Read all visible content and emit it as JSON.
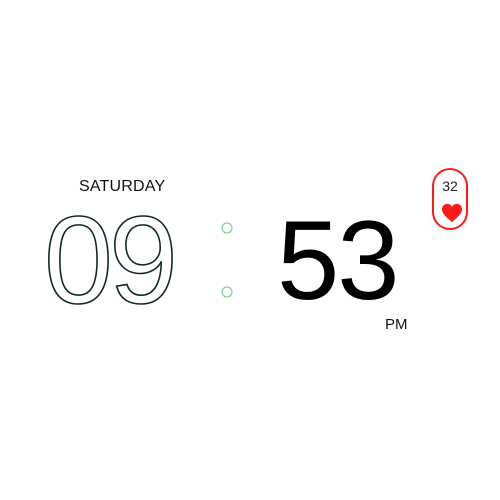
{
  "clock": {
    "day": "SATURDAY",
    "hours": "09",
    "minutes": "53",
    "ampm": "PM"
  },
  "heart_widget": {
    "count": "32",
    "icon": "heart-icon"
  },
  "colors": {
    "background": "#ffffff",
    "hours_outline": "#0f2a1a",
    "separator": "#7fd38a",
    "heart": "#ff1a1a"
  }
}
